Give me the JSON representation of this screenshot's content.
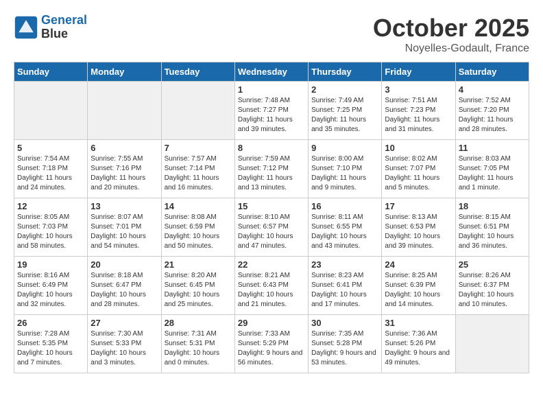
{
  "logo": {
    "line1": "General",
    "line2": "Blue"
  },
  "header": {
    "month_year": "October 2025",
    "location": "Noyelles-Godault, France"
  },
  "weekdays": [
    "Sunday",
    "Monday",
    "Tuesday",
    "Wednesday",
    "Thursday",
    "Friday",
    "Saturday"
  ],
  "days": [
    {
      "date": null,
      "empty": true
    },
    {
      "date": null,
      "empty": true
    },
    {
      "date": null,
      "empty": true
    },
    {
      "date": "1",
      "sunrise": "Sunrise: 7:48 AM",
      "sunset": "Sunset: 7:27 PM",
      "daylight": "Daylight: 11 hours and 39 minutes."
    },
    {
      "date": "2",
      "sunrise": "Sunrise: 7:49 AM",
      "sunset": "Sunset: 7:25 PM",
      "daylight": "Daylight: 11 hours and 35 minutes."
    },
    {
      "date": "3",
      "sunrise": "Sunrise: 7:51 AM",
      "sunset": "Sunset: 7:23 PM",
      "daylight": "Daylight: 11 hours and 31 minutes."
    },
    {
      "date": "4",
      "sunrise": "Sunrise: 7:52 AM",
      "sunset": "Sunset: 7:20 PM",
      "daylight": "Daylight: 11 hours and 28 minutes."
    },
    {
      "date": "5",
      "sunrise": "Sunrise: 7:54 AM",
      "sunset": "Sunset: 7:18 PM",
      "daylight": "Daylight: 11 hours and 24 minutes."
    },
    {
      "date": "6",
      "sunrise": "Sunrise: 7:55 AM",
      "sunset": "Sunset: 7:16 PM",
      "daylight": "Daylight: 11 hours and 20 minutes."
    },
    {
      "date": "7",
      "sunrise": "Sunrise: 7:57 AM",
      "sunset": "Sunset: 7:14 PM",
      "daylight": "Daylight: 11 hours and 16 minutes."
    },
    {
      "date": "8",
      "sunrise": "Sunrise: 7:59 AM",
      "sunset": "Sunset: 7:12 PM",
      "daylight": "Daylight: 11 hours and 13 minutes."
    },
    {
      "date": "9",
      "sunrise": "Sunrise: 8:00 AM",
      "sunset": "Sunset: 7:10 PM",
      "daylight": "Daylight: 11 hours and 9 minutes."
    },
    {
      "date": "10",
      "sunrise": "Sunrise: 8:02 AM",
      "sunset": "Sunset: 7:07 PM",
      "daylight": "Daylight: 11 hours and 5 minutes."
    },
    {
      "date": "11",
      "sunrise": "Sunrise: 8:03 AM",
      "sunset": "Sunset: 7:05 PM",
      "daylight": "Daylight: 11 hours and 1 minute."
    },
    {
      "date": "12",
      "sunrise": "Sunrise: 8:05 AM",
      "sunset": "Sunset: 7:03 PM",
      "daylight": "Daylight: 10 hours and 58 minutes."
    },
    {
      "date": "13",
      "sunrise": "Sunrise: 8:07 AM",
      "sunset": "Sunset: 7:01 PM",
      "daylight": "Daylight: 10 hours and 54 minutes."
    },
    {
      "date": "14",
      "sunrise": "Sunrise: 8:08 AM",
      "sunset": "Sunset: 6:59 PM",
      "daylight": "Daylight: 10 hours and 50 minutes."
    },
    {
      "date": "15",
      "sunrise": "Sunrise: 8:10 AM",
      "sunset": "Sunset: 6:57 PM",
      "daylight": "Daylight: 10 hours and 47 minutes."
    },
    {
      "date": "16",
      "sunrise": "Sunrise: 8:11 AM",
      "sunset": "Sunset: 6:55 PM",
      "daylight": "Daylight: 10 hours and 43 minutes."
    },
    {
      "date": "17",
      "sunrise": "Sunrise: 8:13 AM",
      "sunset": "Sunset: 6:53 PM",
      "daylight": "Daylight: 10 hours and 39 minutes."
    },
    {
      "date": "18",
      "sunrise": "Sunrise: 8:15 AM",
      "sunset": "Sunset: 6:51 PM",
      "daylight": "Daylight: 10 hours and 36 minutes."
    },
    {
      "date": "19",
      "sunrise": "Sunrise: 8:16 AM",
      "sunset": "Sunset: 6:49 PM",
      "daylight": "Daylight: 10 hours and 32 minutes."
    },
    {
      "date": "20",
      "sunrise": "Sunrise: 8:18 AM",
      "sunset": "Sunset: 6:47 PM",
      "daylight": "Daylight: 10 hours and 28 minutes."
    },
    {
      "date": "21",
      "sunrise": "Sunrise: 8:20 AM",
      "sunset": "Sunset: 6:45 PM",
      "daylight": "Daylight: 10 hours and 25 minutes."
    },
    {
      "date": "22",
      "sunrise": "Sunrise: 8:21 AM",
      "sunset": "Sunset: 6:43 PM",
      "daylight": "Daylight: 10 hours and 21 minutes."
    },
    {
      "date": "23",
      "sunrise": "Sunrise: 8:23 AM",
      "sunset": "Sunset: 6:41 PM",
      "daylight": "Daylight: 10 hours and 17 minutes."
    },
    {
      "date": "24",
      "sunrise": "Sunrise: 8:25 AM",
      "sunset": "Sunset: 6:39 PM",
      "daylight": "Daylight: 10 hours and 14 minutes."
    },
    {
      "date": "25",
      "sunrise": "Sunrise: 8:26 AM",
      "sunset": "Sunset: 6:37 PM",
      "daylight": "Daylight: 10 hours and 10 minutes."
    },
    {
      "date": "26",
      "sunrise": "Sunrise: 7:28 AM",
      "sunset": "Sunset: 5:35 PM",
      "daylight": "Daylight: 10 hours and 7 minutes."
    },
    {
      "date": "27",
      "sunrise": "Sunrise: 7:30 AM",
      "sunset": "Sunset: 5:33 PM",
      "daylight": "Daylight: 10 hours and 3 minutes."
    },
    {
      "date": "28",
      "sunrise": "Sunrise: 7:31 AM",
      "sunset": "Sunset: 5:31 PM",
      "daylight": "Daylight: 10 hours and 0 minutes."
    },
    {
      "date": "29",
      "sunrise": "Sunrise: 7:33 AM",
      "sunset": "Sunset: 5:29 PM",
      "daylight": "Daylight: 9 hours and 56 minutes."
    },
    {
      "date": "30",
      "sunrise": "Sunrise: 7:35 AM",
      "sunset": "Sunset: 5:28 PM",
      "daylight": "Daylight: 9 hours and 53 minutes."
    },
    {
      "date": "31",
      "sunrise": "Sunrise: 7:36 AM",
      "sunset": "Sunset: 5:26 PM",
      "daylight": "Daylight: 9 hours and 49 minutes."
    },
    {
      "date": null,
      "empty": true
    }
  ]
}
